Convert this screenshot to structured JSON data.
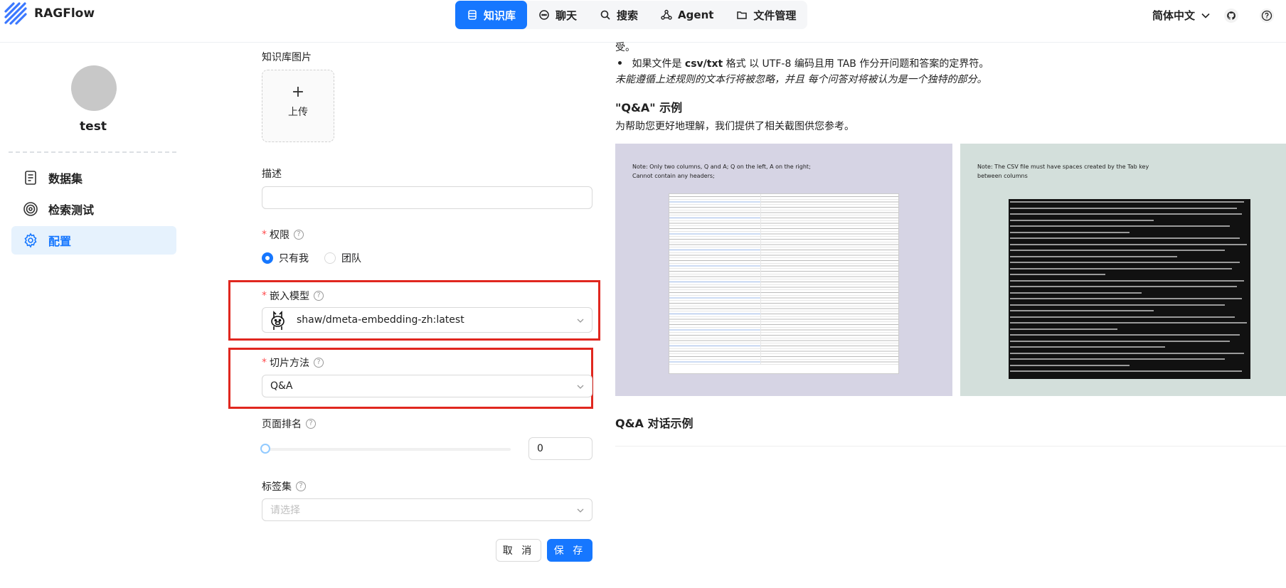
{
  "header": {
    "brand": "RAGFlow",
    "nav": [
      {
        "label": "知识库",
        "icon": "database-icon",
        "active": true
      },
      {
        "label": "聊天",
        "icon": "chat-icon",
        "active": false
      },
      {
        "label": "搜索",
        "icon": "search-icon",
        "active": false
      },
      {
        "label": "Agent",
        "icon": "agent-icon",
        "active": false
      },
      {
        "label": "文件管理",
        "icon": "folder-icon",
        "active": false
      }
    ],
    "language": "简体中文"
  },
  "sidebar": {
    "kb_name": "test",
    "items": [
      {
        "label": "数据集",
        "icon": "document-icon",
        "active": false
      },
      {
        "label": "检索测试",
        "icon": "target-icon",
        "active": false
      },
      {
        "label": "配置",
        "icon": "gear-icon",
        "active": true
      }
    ]
  },
  "form": {
    "image_label": "知识库图片",
    "upload_plus": "+",
    "upload_label": "上传",
    "description_label": "描述",
    "description_value": "",
    "permission_label": "权限",
    "permission_options": [
      "只有我",
      "团队"
    ],
    "permission_selected": "只有我",
    "required_mark": "*",
    "help_mark": "?",
    "embedding_label": "嵌入模型",
    "embedding_value": "shaw/dmeta-embedding-zh:latest",
    "chunk_method_label": "切片方法",
    "chunk_method_value": "Q&A",
    "page_rank_label": "页面排名",
    "page_rank_value": "0",
    "page_rank_slider": 0,
    "tag_set_label": "标签集",
    "tag_set_placeholder": "请选择",
    "cancel_label": "取 消",
    "save_label": "保 存"
  },
  "right_panel": {
    "top_fragment": "受。",
    "bullet_prefix": "如果文件是 ",
    "bullet_bold": "csv/txt",
    "bullet_suffix": " 格式 以 UTF-8 编码且用 TAB 作分开问题和答案的定界符。",
    "italic_note": "未能遵循上述规则的文本行将被忽略，并且 每个问答对将被认为是一个独特的部分。",
    "qa_example_heading": "\"Q&A\" 示例",
    "screenshot_note": "为帮助您更好地理解，我们提供了相关截图供您参考。",
    "image1_note_line1": "Note: Only two columns, Q and A; Q on the left, A on the right;",
    "image1_note_line2": "Cannot contain any headers;",
    "image2_note_line1": "Note: The CSV file must have spaces created by the Tab key",
    "image2_note_line2": "between columns",
    "dialog_example_heading": "Q&A 对话示例"
  },
  "colors": {
    "accent": "#1677ff",
    "highlight_box": "#e0271f",
    "image1_bg": "#d6d4e4",
    "image2_bg": "#d3dfdb"
  }
}
